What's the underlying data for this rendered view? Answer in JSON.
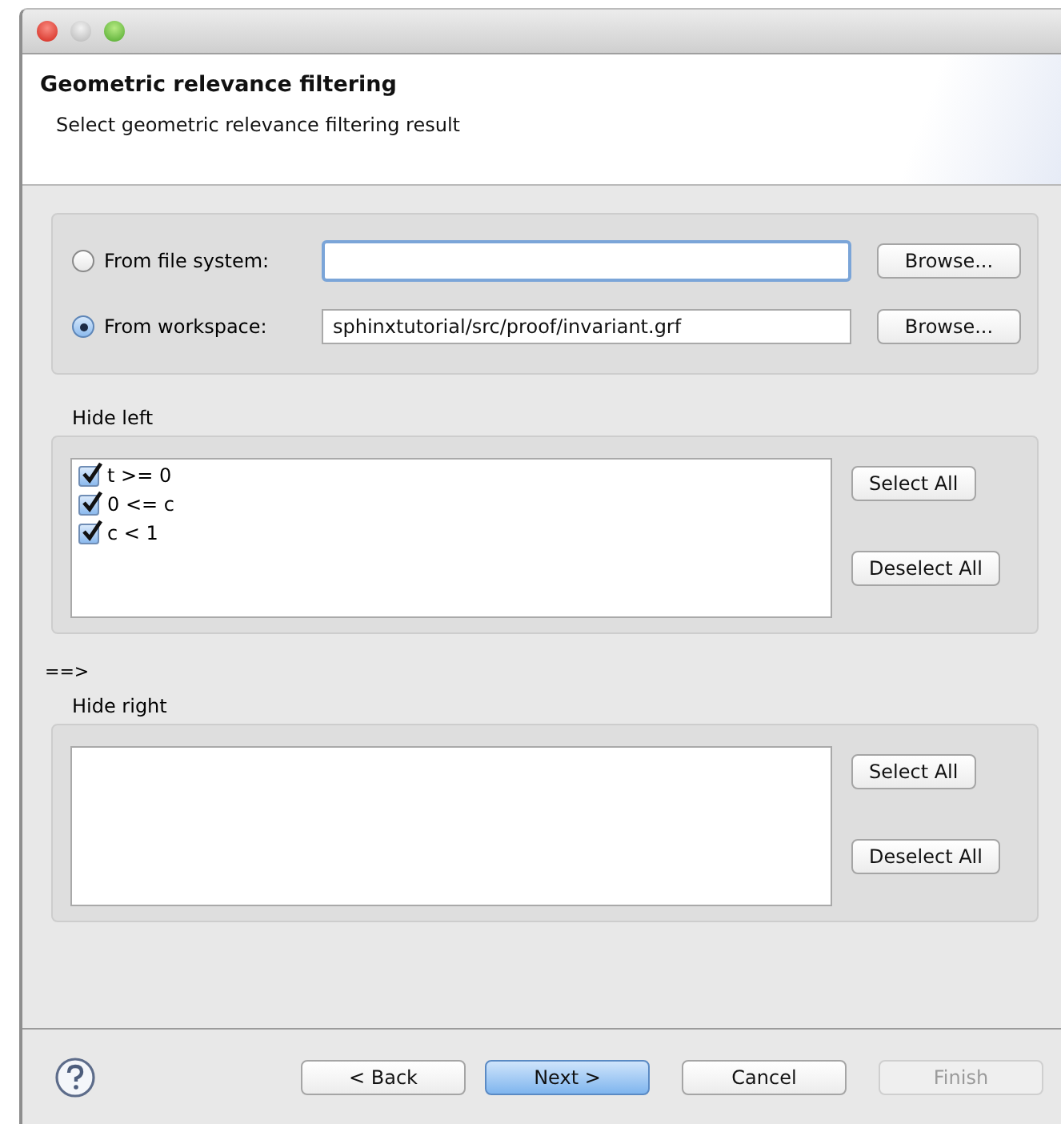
{
  "header": {
    "title": "Geometric relevance filtering",
    "subtitle": "Select geometric relevance filtering result"
  },
  "source": [
    {
      "label": "From file system:",
      "selected": false,
      "focused": true,
      "button": "Browse..."
    },
    {
      "label": "From workspace:",
      "selected": true,
      "value": "sphinxtutorial/src/proof/invariant.grf",
      "focused": false,
      "button": "Browse..."
    }
  ],
  "hide_left": {
    "label": "Hide left",
    "items": [
      {
        "label": "t >= 0",
        "checked": true
      },
      {
        "label": "0 <= c",
        "checked": true
      },
      {
        "label": "c < 1",
        "checked": true
      }
    ],
    "buttons": [
      "Select All",
      "Deselect All"
    ]
  },
  "arrow": "==>",
  "hide_right": {
    "label": "Hide right",
    "buttons": [
      "Select All",
      "Deselect All"
    ]
  },
  "footer": [
    {
      "label": "< Back",
      "default": false,
      "disabled": false
    },
    {
      "label": "Next >",
      "default": true,
      "disabled": false
    },
    {
      "label": "Cancel",
      "default": false,
      "disabled": false
    },
    {
      "label": "Finish",
      "default": false,
      "disabled": true
    }
  ]
}
